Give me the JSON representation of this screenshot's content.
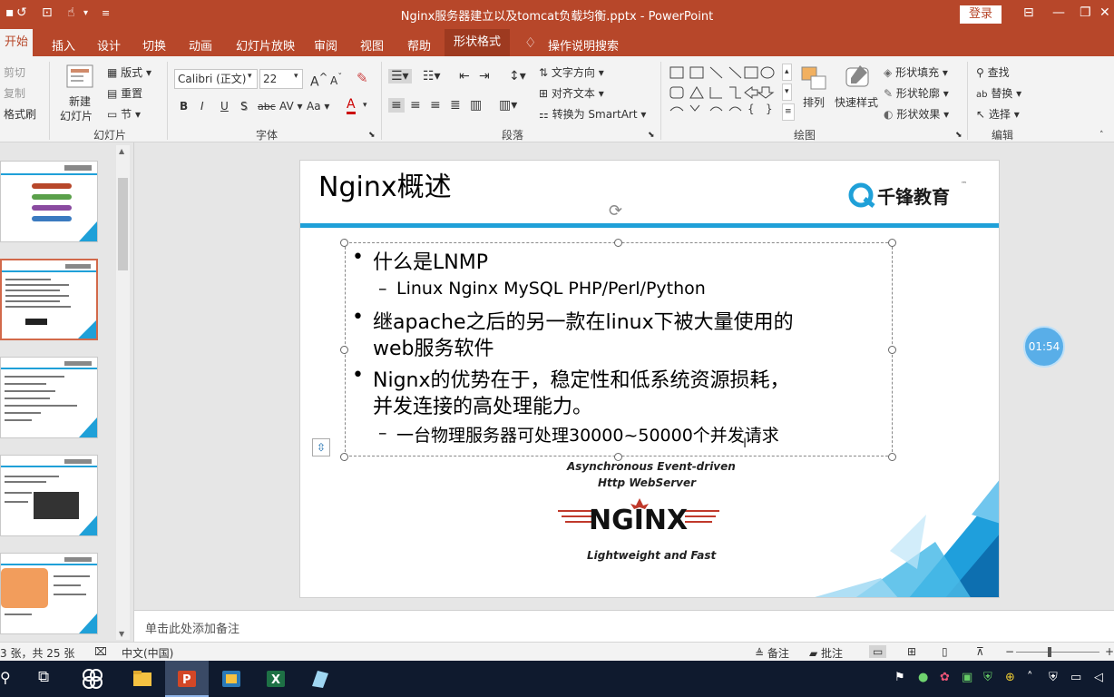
{
  "title_bar": {
    "document_title": "Nginx服务器建立以及tomcat负载均衡.pptx  -  PowerPoint",
    "login_label": "登录"
  },
  "tabs": [
    "开始",
    "插入",
    "设计",
    "切换",
    "动画",
    "幻灯片放映",
    "审阅",
    "视图",
    "帮助",
    "形状格式"
  ],
  "tell_me": "操作说明搜索",
  "ribbon": {
    "clipboard": {
      "cut": "剪切",
      "copy": "复制",
      "format_painter": "格式刷"
    },
    "slides": {
      "new_slide_line1": "新建",
      "new_slide_line2": "幻灯片",
      "layout": "版式",
      "reset": "重置",
      "section": "节",
      "group_label": "幻灯片"
    },
    "font": {
      "font_name": "Calibri (正文)",
      "font_size": "22",
      "group_label": "字体",
      "bold": "B",
      "italic": "I",
      "underline": "U",
      "shadow": "S",
      "strike": "abc",
      "spacing": "AV",
      "case": "Aa",
      "color": "A"
    },
    "paragraph": {
      "text_direction": "文字方向",
      "align_text": "对齐文本",
      "smartart": "转换为 SmartArt",
      "group_label": "段落"
    },
    "drawing": {
      "arrange": "排列",
      "quick_styles": "快速样式",
      "shape_fill": "形状填充",
      "shape_outline": "形状轮廓",
      "shape_effects": "形状效果",
      "group_label": "绘图"
    },
    "editing": {
      "find": "查找",
      "replace": "替换",
      "select": "选择",
      "group_label": "编辑"
    }
  },
  "slide": {
    "title": "Nginx概述",
    "logo_text": "千锋教育",
    "bullets": [
      "什么是LNMP",
      "Linux Nginx MySQL PHP/Perl/Python",
      "继apache之后的另一款在linux下被大量使用的",
      "web服务软件",
      "Nignx的优势在于，稳定性和低系统资源损耗，",
      "并发连接的高处理能力。",
      "一台物理服务器可处理30000~50000个并发请求"
    ],
    "nginx_tagline_1": "Asynchronous Event-driven",
    "nginx_tagline_2": "Http WebServer",
    "nginx_word": "NGINX",
    "nginx_tagline_3": "Lightweight and Fast"
  },
  "notes_placeholder": "单击此处添加备注",
  "status_bar": {
    "slide_count": "3 张，共 25 张",
    "language": "中文(中国)",
    "notes": "备注",
    "comments": "批注"
  },
  "timer": "01:54",
  "colors": {
    "accent": "#b7472a",
    "slide_line": "#1fa0d8",
    "taskbar": "#0f1a2e"
  }
}
